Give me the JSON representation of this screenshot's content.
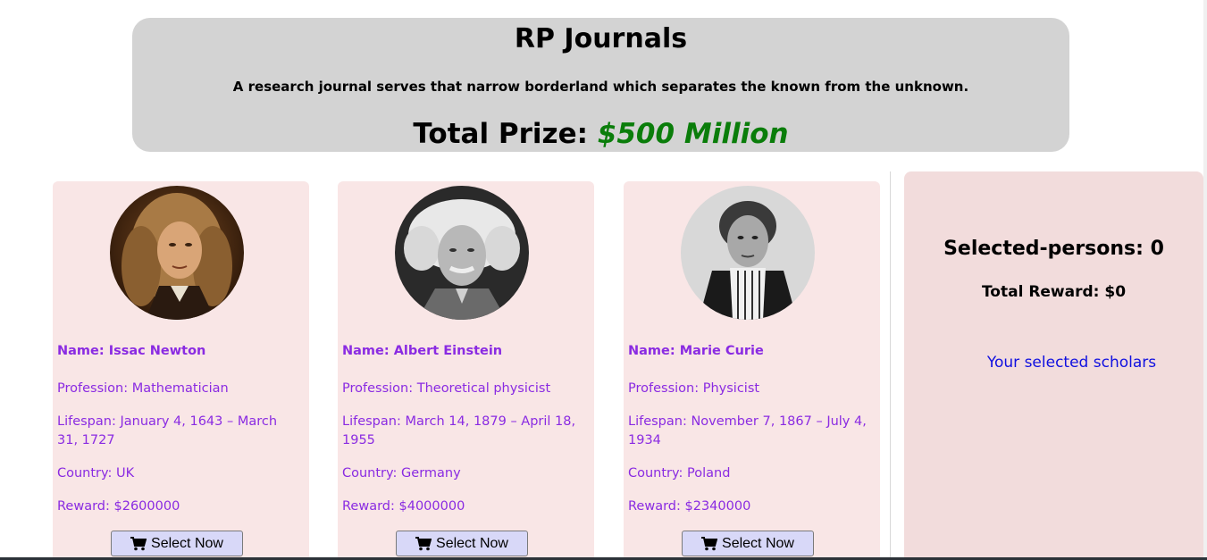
{
  "header": {
    "title": "RP Journals",
    "tagline": "A research journal serves that narrow borderland which separates the known from the unknown.",
    "prize_label": "Total Prize: ",
    "prize_amount": "$500 Million"
  },
  "scholars": [
    {
      "name": "Name: Issac Newton",
      "profession": "Profession: Mathematician",
      "lifespan": "Lifespan: January 4, 1643 – March 31, 1727",
      "country": "Country: UK",
      "reward": "Reward: $2600000",
      "button": "Select Now"
    },
    {
      "name": "Name: Albert Einstein",
      "profession": "Profession: Theoretical physicist",
      "lifespan": "Lifespan: March 14, 1879 – April 18, 1955",
      "country": "Country: Germany",
      "reward": "Reward: $4000000",
      "button": "Select Now"
    },
    {
      "name": "Name: Marie Curie",
      "profession": "Profession: Physicist",
      "lifespan": "Lifespan: November 7, 1867 – July 4, 1934",
      "country": "Country: Poland",
      "reward": "Reward: $2340000",
      "button": "Select Now"
    }
  ],
  "panel": {
    "selected_persons": "Selected-persons: 0",
    "total_reward": "Total Reward: $0",
    "selected_scholars_title": "Your selected scholars"
  },
  "colors": {
    "header_bg": "#d3d3d3",
    "prize_green": "#0a7d0a",
    "card_bg": "#f9e6e6",
    "card_text": "#8a2be2",
    "panel_bg": "#f2dcdc",
    "link_blue": "#1010e0",
    "button_bg": "#d8d8f8"
  },
  "icons": {
    "button_icon": "cart-icon"
  }
}
